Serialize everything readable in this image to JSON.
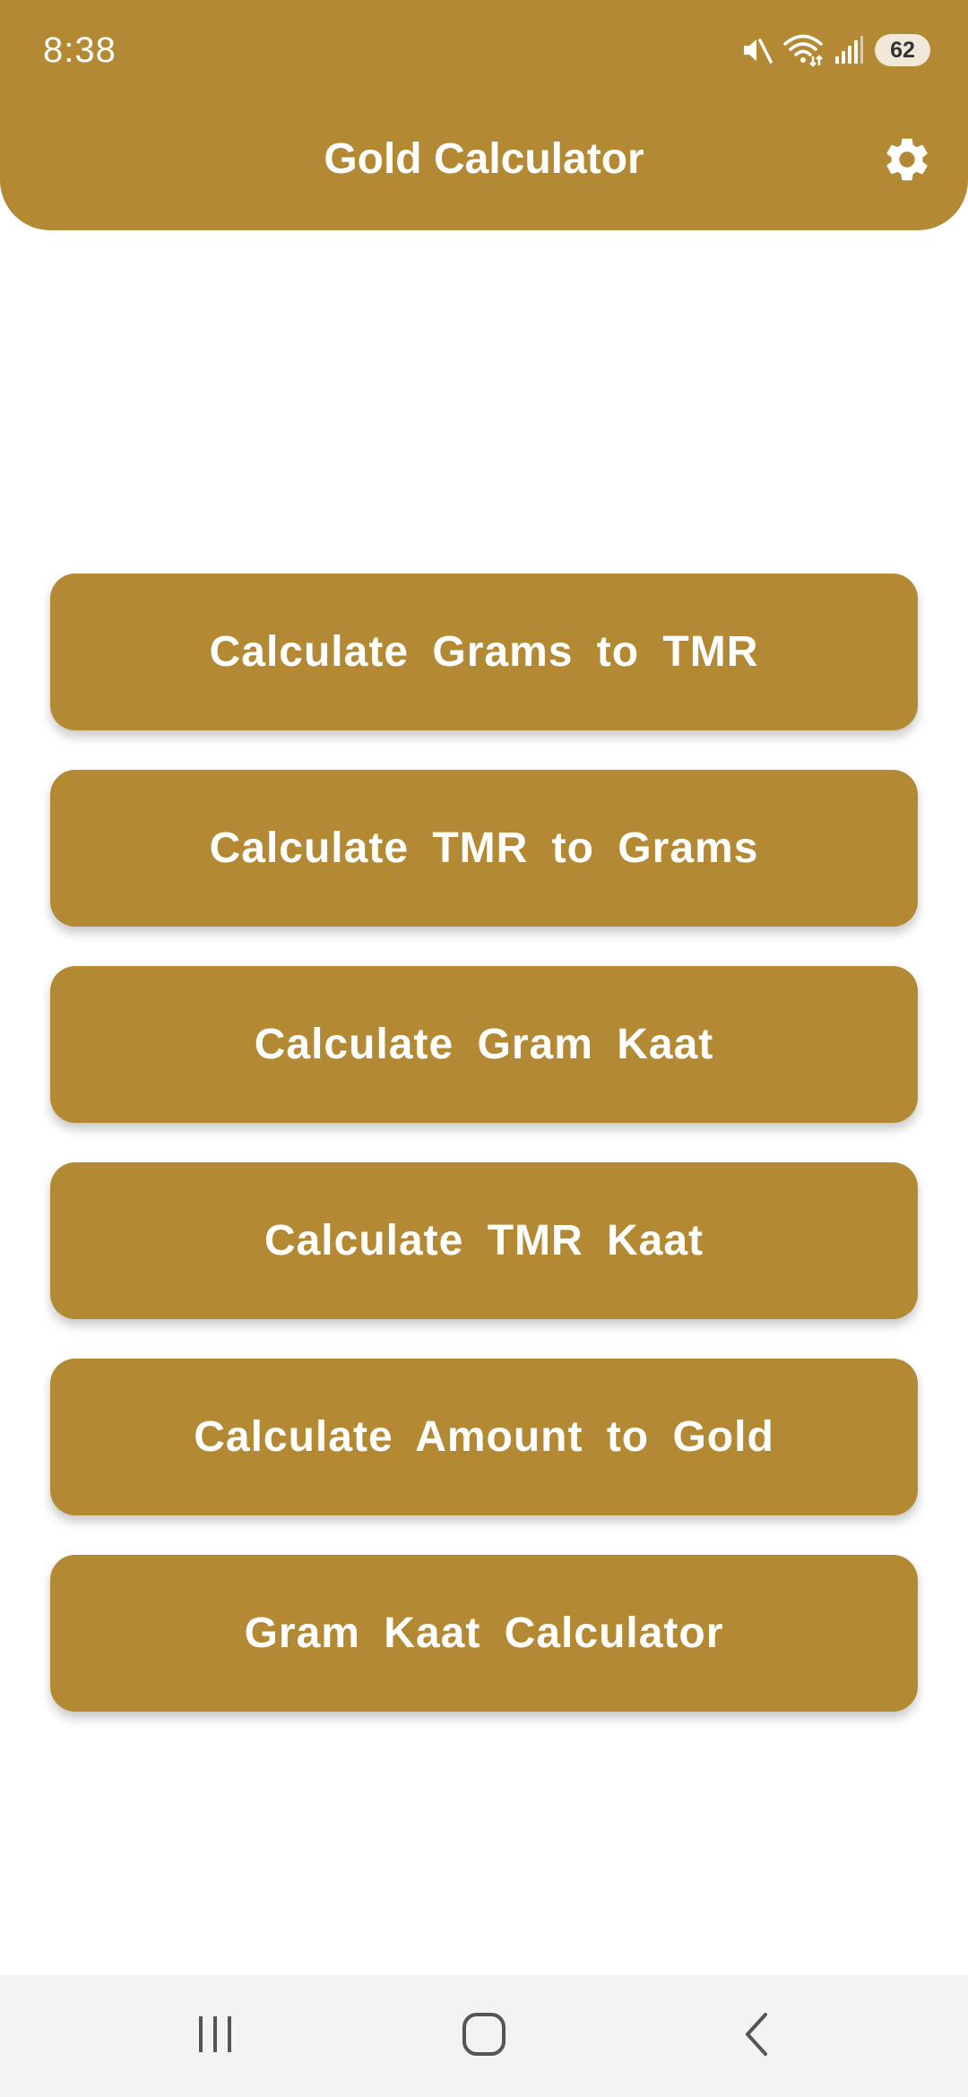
{
  "status_bar": {
    "time": "8:38",
    "battery": "62",
    "icons": [
      "mute-icon",
      "wifi-icon",
      "signal-icon",
      "battery-icon"
    ]
  },
  "header": {
    "title": "Gold Calculator",
    "settings_icon": "gear-icon"
  },
  "menu": {
    "items": [
      {
        "label": "Calculate Grams to TMR"
      },
      {
        "label": "Calculate TMR to Grams"
      },
      {
        "label": "Calculate Gram Kaat"
      },
      {
        "label": "Calculate TMR Kaat"
      },
      {
        "label": "Calculate Amount to Gold"
      },
      {
        "label": "Gram Kaat Calculator"
      }
    ]
  },
  "navigation_bar": {
    "icons": [
      "recent-apps-icon",
      "home-icon",
      "back-icon"
    ]
  },
  "colors": {
    "accent": "#b38933",
    "text_on_accent": "#ffffff",
    "background": "#ffffff",
    "nav_bar": "#f3f3f3"
  }
}
